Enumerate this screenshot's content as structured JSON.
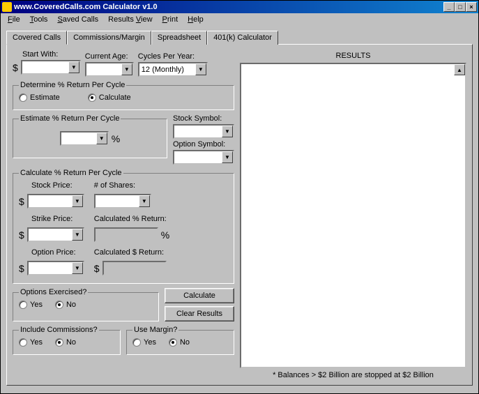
{
  "title": "www.CoveredCalls.com Calculator v1.0",
  "menu": {
    "file": "File",
    "tools": "Tools",
    "saved": "Saved Calls",
    "results": "Results View",
    "print": "Print",
    "help": "Help"
  },
  "tabs": {
    "covered": "Covered Calls",
    "commissions": "Commissions/Margin",
    "spreadsheet": "Spreadsheet",
    "k401": "401(k) Calculator"
  },
  "labels": {
    "start_with": "Start With:",
    "current_age": "Current Age:",
    "cycles_per_year": "Cycles Per Year:",
    "cycles_value": "12 (Monthly)",
    "grp_determine": "Determine % Return Per Cycle",
    "estimate": "Estimate",
    "calculate_radio": "Calculate",
    "grp_est": "Estimate % Return Per Cycle",
    "percent": "%",
    "stock_symbol": "Stock Symbol:",
    "option_symbol": "Option Symbol:",
    "grp_calc": "Calculate % Return Per Cycle",
    "stock_price": "Stock Price:",
    "num_shares": "# of Shares:",
    "strike_price": "Strike Price:",
    "calc_pct_return": "Calculated % Return:",
    "option_price": "Option Price:",
    "calc_dollar_return": "Calculated $ Return:",
    "grp_exercised": "Options Exercised?",
    "grp_commissions": "Include Commissions?",
    "grp_margin": "Use Margin?",
    "yes": "Yes",
    "no": "No",
    "btn_calculate": "Calculate",
    "btn_clear": "Clear Results",
    "results": "RESULTS",
    "footnote": "* Balances > $2 Billion are stopped at $2 Billion"
  }
}
